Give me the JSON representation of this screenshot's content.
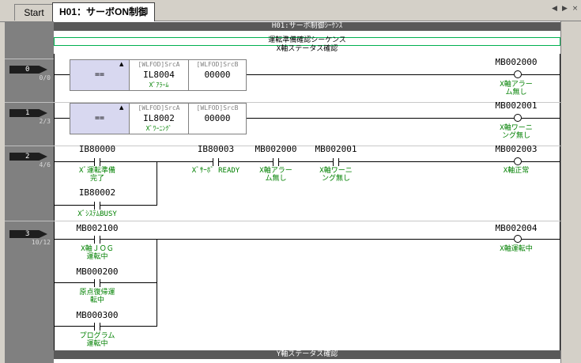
{
  "tabs": {
    "inactive": "Start",
    "active": "H01：サーボON制御"
  },
  "controls": {
    "left": "◀",
    "right": "▶",
    "close": "×"
  },
  "sheet": {
    "header": "H01:サーボ制御ｼｰｹﾝｽ",
    "comment1": "運転準備確認シーケンス",
    "comment2": "X軸ステータス確認",
    "footer": "Y軸ステータス確認"
  },
  "steps": [
    {
      "no": "0",
      "count": "0/0"
    },
    {
      "no": "1",
      "count": "2/3"
    },
    {
      "no": "2",
      "count": "4/6"
    },
    {
      "no": "3",
      "count": "10/12"
    }
  ],
  "rung0": {
    "op": "==",
    "srcA_label": "[WLFOD]SrcA",
    "srcA": "IL8004",
    "srcA_cmt": "Xﾞｱﾗｰﾑ",
    "srcB_label": "[WLFOD]SrcB",
    "srcB": "00000",
    "coil": "MB002000",
    "coil_cmt1": "X軸アラー",
    "coil_cmt2": "ム無し"
  },
  "rung1": {
    "op": "==",
    "srcA_label": "[WLFOD]SrcA",
    "srcA": "IL8002",
    "srcA_cmt": "Xﾞﾜｰﾆﾝｸﾞ",
    "srcB_label": "[WLFOD]SrcB",
    "srcB": "00000",
    "coil": "MB002001",
    "coil_cmt1": "X軸ワーニ",
    "coil_cmt2": "ング無し"
  },
  "rung2": {
    "c1": "IB80000",
    "c1_cmt1": "Xﾞ運転準備",
    "c1_cmt2": "完了",
    "c2": "IB80002",
    "c2_cmt1": "XﾞｼｽﾃﾑBUSY",
    "c3": "IB80003",
    "c3_cmt1": "Xﾞｻｰﾎﾞ READY",
    "c4": "MB002000",
    "c4_cmt1": "X軸アラー",
    "c4_cmt2": "ム無し",
    "c5": "MB002001",
    "c5_cmt1": "X軸ワーニ",
    "c5_cmt2": "ング無し",
    "coil": "MB002003",
    "coil_cmt1": "X軸正常"
  },
  "rung3": {
    "c1": "MB002100",
    "c1_cmt1": "X軸ＪＯＧ",
    "c1_cmt2": "運転中",
    "c2": "MB000200",
    "c2_cmt1": "原点復帰運",
    "c2_cmt2": "転中",
    "c3": "MB000300",
    "c3_cmt1": "プログラム",
    "c3_cmt2": "運転中",
    "coil": "MB002004",
    "coil_cmt1": "X軸運転中"
  }
}
